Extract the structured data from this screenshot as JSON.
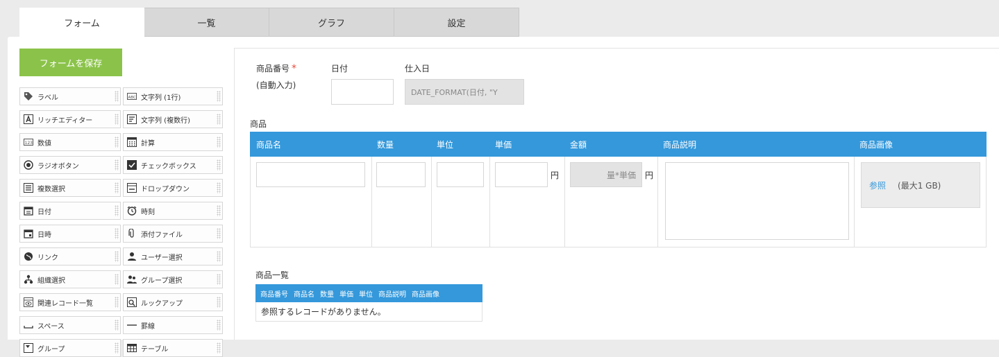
{
  "tabs": [
    {
      "label": "フォーム",
      "active": true
    },
    {
      "label": "一覧",
      "active": false
    },
    {
      "label": "グラフ",
      "active": false
    },
    {
      "label": "設定",
      "active": false
    }
  ],
  "palette": {
    "save_label": "フォームを保存",
    "left": [
      {
        "label": "ラベル",
        "icon": "label-tag-icon"
      },
      {
        "label": "リッチエディター",
        "icon": "rich-editor-icon"
      },
      {
        "label": "数値",
        "icon": "number-icon"
      },
      {
        "label": "ラジオボタン",
        "icon": "radio-button-icon"
      },
      {
        "label": "複数選択",
        "icon": "multi-select-icon"
      },
      {
        "label": "日付",
        "icon": "calendar-date-icon"
      },
      {
        "label": "日時",
        "icon": "calendar-datetime-icon"
      },
      {
        "label": "リンク",
        "icon": "globe-link-icon"
      },
      {
        "label": "組織選択",
        "icon": "org-select-icon"
      },
      {
        "label": "関連レコード一覧",
        "icon": "related-records-icon"
      },
      {
        "label": "スペース",
        "icon": "space-icon"
      },
      {
        "label": "グループ",
        "icon": "group-icon"
      }
    ],
    "right": [
      {
        "label": "文字列 (1行)",
        "icon": "text-single-icon"
      },
      {
        "label": "文字列 (複数行)",
        "icon": "text-multi-icon"
      },
      {
        "label": "計算",
        "icon": "calculator-icon"
      },
      {
        "label": "チェックボックス",
        "icon": "checkbox-icon"
      },
      {
        "label": "ドロップダウン",
        "icon": "dropdown-icon"
      },
      {
        "label": "時刻",
        "icon": "clock-icon"
      },
      {
        "label": "添付ファイル",
        "icon": "attachment-icon"
      },
      {
        "label": "ユーザー選択",
        "icon": "user-select-icon"
      },
      {
        "label": "グループ選択",
        "icon": "group-select-icon"
      },
      {
        "label": "ルックアップ",
        "icon": "lookup-icon"
      },
      {
        "label": "罫線",
        "icon": "divider-line-icon"
      },
      {
        "label": "テーブル",
        "icon": "table-icon"
      }
    ]
  },
  "form": {
    "product_no_label": "商品番号",
    "required_mark": "*",
    "auto_input": "(自動入力)",
    "date_label": "日付",
    "date_value": "",
    "purchase_label": "仕入日",
    "purchase_value": "DATE_FORMAT(日付, \"Y",
    "section_label": "商品"
  },
  "table": {
    "headers": [
      "商品名",
      "数量",
      "単位",
      "単価",
      "金額",
      "商品説明",
      "商品画像"
    ],
    "currency": "円",
    "amount_formula": "量*単価",
    "browse_label": "参照",
    "max_size": "(最大1 GB)"
  },
  "related": {
    "title": "商品一覧",
    "headers": [
      "商品番号",
      "商品名",
      "数量",
      "単価",
      "単位",
      "商品説明",
      "商品画像"
    ],
    "empty": "参照するレコードがありません。"
  },
  "colors": {
    "accent_blue": "#3498db",
    "save_green": "#8bc34a",
    "required_red": "#e74c3c"
  }
}
